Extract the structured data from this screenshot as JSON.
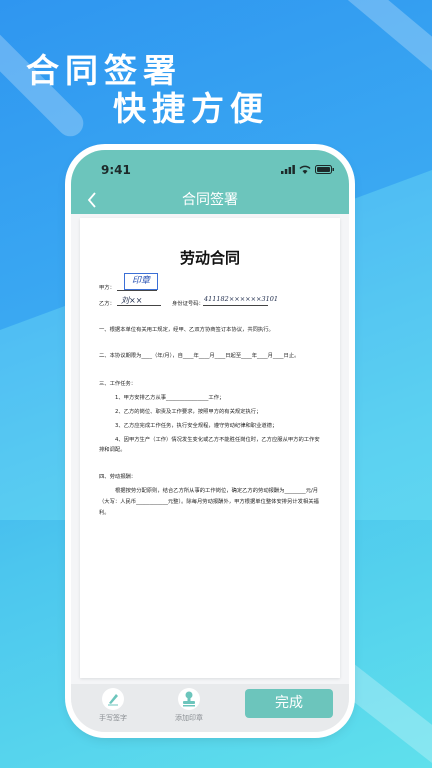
{
  "banner": {
    "line1": "合同签署",
    "line2": "快捷方便"
  },
  "status_bar": {
    "time": "9:41"
  },
  "nav": {
    "title": "合同签署",
    "back_icon": "chevron-left-icon"
  },
  "document": {
    "title": "劳动合同",
    "party_a_label": "甲方：",
    "party_a_stamp": "印章",
    "party_b_label": "乙方：",
    "party_b_signature": "刘××",
    "id_label": "身份证号码：",
    "id_signature": "411182××××××3101",
    "clause1": "一、根据本单位有关用工规定，经甲、乙双方协商签订本协议，共同执行。",
    "clause2": "二、本协议期限为____（年/月），自____年____月____日起至____年____月____日止。",
    "section3": "三、工作任务：",
    "item3_1": "1、甲方安排乙方从事________________工作；",
    "item3_2": "2、乙方的岗位、职责及工作要求，按照甲方的有关规定执行；",
    "item3_3": "3、乙方应完成工作任务，执行安全规程，遵守劳动纪律和职业道德；",
    "item3_4": "4、因甲方生产（工作）情况发生变化或乙方不能胜任岗位时，乙方应服从甲方的工作安排和调配。",
    "section4": "四、劳动报酬：",
    "para4": "根据按劳分配原则，结合乙方所从事的工作岗位，确定乙方的劳动报酬为________元/月（大写：人民币____________元整）。除每月劳动报酬外，甲方根据单位整体安排另计发相关福利。"
  },
  "toolbar": {
    "sign_label": "手写签字",
    "stamp_label": "添加印章",
    "done_label": "完成"
  },
  "colors": {
    "accent": "#6cc5bc",
    "bg_top": "#2f96f0",
    "bg_bottom": "#5fe0ec"
  }
}
